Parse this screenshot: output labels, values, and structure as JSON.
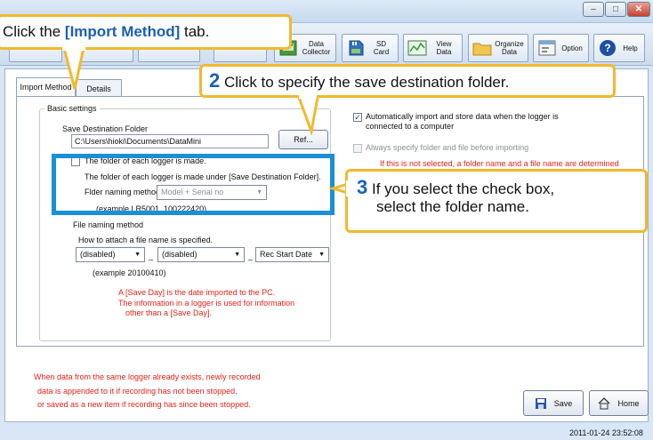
{
  "window": {
    "controls": [
      "–",
      "□",
      "✕"
    ]
  },
  "toolbar": {
    "buttons": [
      {
        "label": "Data\nCollector",
        "icon": "data-collector-icon"
      },
      {
        "label": "SD Card",
        "icon": "sd-card-icon"
      },
      {
        "label": "View\nData",
        "icon": "view-data-icon"
      },
      {
        "label": "Organize\nData",
        "icon": "folder-icon"
      },
      {
        "label": "Option",
        "icon": "option-icon"
      },
      {
        "label": "Help",
        "icon": "help-icon"
      }
    ]
  },
  "tabs": [
    "Import Method",
    "Details"
  ],
  "basic_settings": {
    "legend": "Basic settings",
    "save_dest_label": "Save Destination Folder",
    "save_dest_value": "C:\\Users\\hioki\\Documents\\DataMini",
    "ref_button": "Ref...",
    "folder_check_label": "The folder of each logger is made.",
    "folder_desc": "The folder of each logger is made under [Save Destination Folder].",
    "folder_naming_label": "Flder naming method",
    "folder_naming_value": "Model + Serial no",
    "folder_example": "(example    LR5001_100222420)",
    "file_naming_label": "File naming method",
    "file_naming_desc": "How to attach a file name is specified.",
    "file_select_1": "(disabled)",
    "file_select_2": "(disabled)",
    "file_select_3": "Rec Start Date",
    "file_example": "(example    20100410)",
    "note_line1": "A [Save Day] is the date imported to the PC.",
    "note_line2": "The information in a logger is used for information",
    "note_line3": "other than a [Save Day]."
  },
  "right_panel": {
    "auto_import_label_1": "Automatically import and store data when the logger is",
    "auto_import_label_2": "connected to a computer",
    "auto_import_checked": true,
    "always_specify_label": "Always specify folder and file before importing",
    "always_specify_note": "If this is not selected, a folder name and a file name are determined"
  },
  "footer_note": {
    "line1": "When data from the same logger already exists, newly recorded",
    "line2": "data is appended to it if recording has not been stopped,",
    "line3": "or saved as a new item if recording has since been stopped."
  },
  "bottom_buttons": {
    "save": "Save",
    "home": "Home"
  },
  "status": {
    "timestamp": "2011-01-24 23:52:08"
  },
  "callouts": {
    "c1_prefix": "Click the ",
    "c1_highlight": "[Import Method]",
    "c1_suffix": " tab.",
    "c2_num": "2",
    "c2_text": "Click to specify the save destination folder.",
    "c3_num": "3",
    "c3_line1": "If you select the check box,",
    "c3_line2": "select the folder name."
  },
  "colors": {
    "callout_border": "#f2b92d",
    "callout_accent": "#1a5fb4",
    "highlight_box": "#1b8fd8",
    "note_red": "#e2231a"
  }
}
